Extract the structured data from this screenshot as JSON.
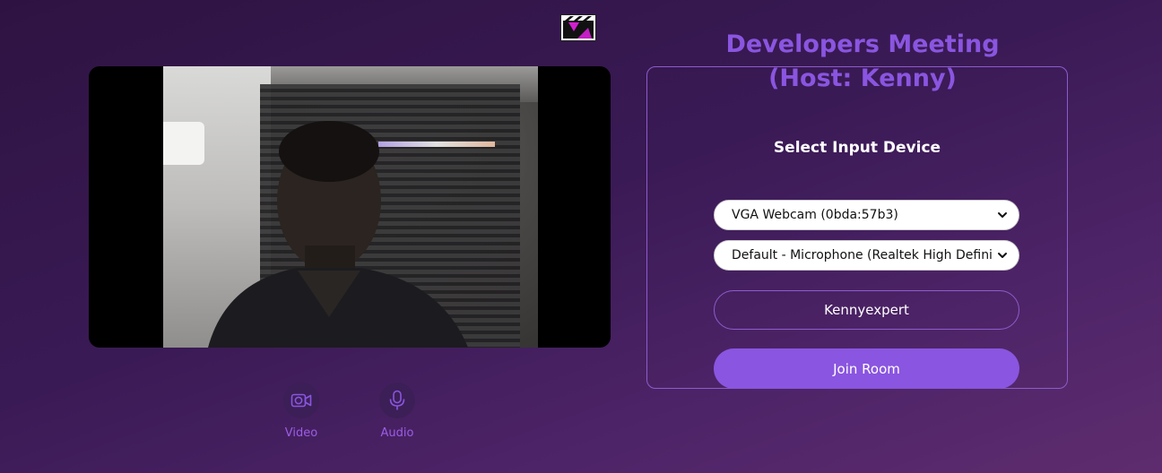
{
  "header": {
    "logo_icon": "clapperboard-icon"
  },
  "preview": {
    "toggles": [
      {
        "label": "Video",
        "icon": "video-camera-icon"
      },
      {
        "label": "Audio",
        "icon": "microphone-icon"
      }
    ]
  },
  "join_panel": {
    "title": "Developers Meeting (Host: Kenny)",
    "section_heading": "Select Input Device",
    "camera_select": {
      "selected": "VGA Webcam (0bda:57b3)"
    },
    "microphone_select": {
      "selected": "Default - Microphone (Realtek High Definition Audio)"
    },
    "name_input": {
      "value": "Kennyexpert"
    },
    "join_button_label": "Join Room"
  },
  "colors": {
    "accent": "#8a55e0",
    "background_start": "#2e1342",
    "background_end": "#5e2c6e",
    "border": "#8d5ccc"
  }
}
